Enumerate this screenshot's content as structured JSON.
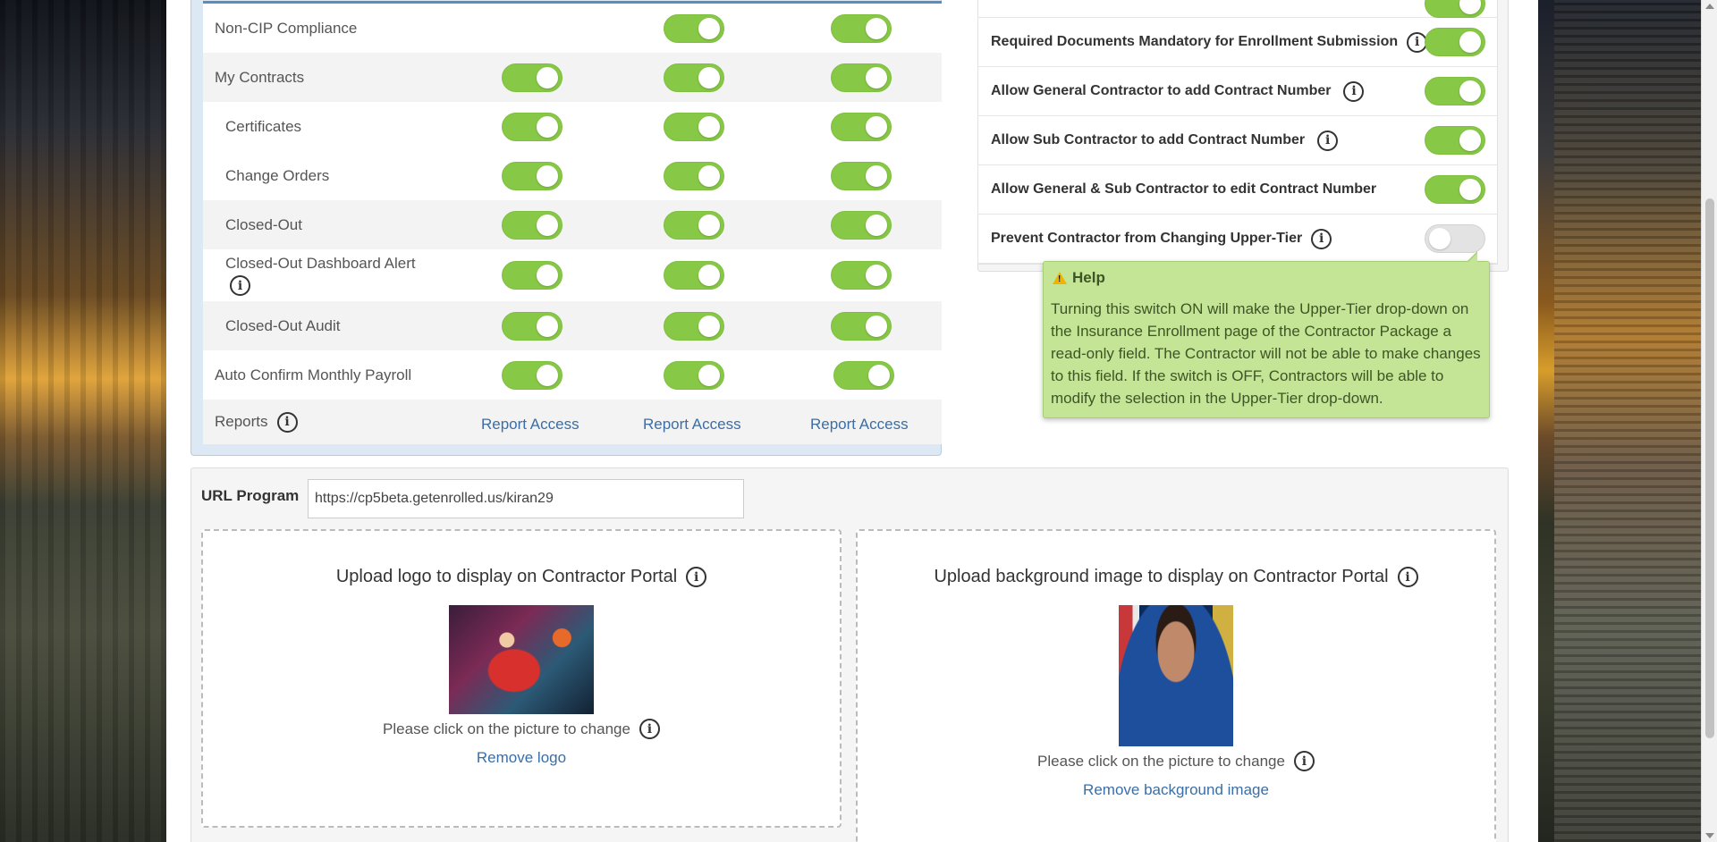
{
  "matrix": {
    "rows": [
      {
        "label": "Non-CIP Compliance",
        "toggles": [
          null,
          true,
          true
        ]
      },
      {
        "label": "My Contracts",
        "toggles": [
          true,
          true,
          true
        ]
      },
      {
        "label": "Certificates",
        "toggles": [
          true,
          true,
          true
        ]
      },
      {
        "label": "Change Orders",
        "toggles": [
          true,
          true,
          true
        ]
      },
      {
        "label": "Closed-Out",
        "toggles": [
          true,
          true,
          true
        ]
      },
      {
        "label": "Closed-Out Dashboard Alert",
        "toggles": [
          true,
          true,
          true
        ]
      },
      {
        "label": "Closed-Out Audit",
        "toggles": [
          true,
          true,
          true
        ]
      },
      {
        "label": "Auto Confirm Monthly Payroll",
        "toggles": [
          true,
          true,
          true
        ]
      }
    ],
    "reports_label": "Reports",
    "report_links": [
      "Report Access",
      "Report Access",
      "Report Access"
    ]
  },
  "settings": {
    "rows": [
      {
        "label": "Required Documents Mandatory for Enrollment Submission",
        "on": true
      },
      {
        "label": "Allow General Contractor to add Contract Number",
        "on": true
      },
      {
        "label": "Allow Sub Contractor to add Contract Number",
        "on": true
      },
      {
        "label": "Allow General & Sub Contractor to edit Contract Number",
        "on": true
      },
      {
        "label": "Prevent Contractor from Changing Upper-Tier",
        "on": false
      }
    ]
  },
  "help": {
    "title": "Help",
    "body": "Turning this switch ON will make the Upper-Tier drop-down on the Insurance Enrollment page of the Contractor Package a read-only field. The Contractor will not be able to make changes to this field. If the switch is OFF, Contractors will be able to modify the selection in the Upper-Tier drop-down."
  },
  "url_program": {
    "label": "URL Program",
    "value": "https://cp5beta.getenrolled.us/kiran29"
  },
  "logo_upload": {
    "title": "Upload logo to display on Contractor Portal",
    "hint": "Please click on the picture to change",
    "remove": "Remove logo"
  },
  "background_upload": {
    "title": "Upload background image to display on Contractor Portal",
    "hint": "Please click on the picture to change",
    "remove": "Remove background image"
  },
  "colors": {
    "toggle_on": "#87c846",
    "toggle_off": "#e3e3e3",
    "link": "#3a6ea5",
    "help_bg": "#c3e595",
    "matrix_header": "#5b8cc0"
  }
}
